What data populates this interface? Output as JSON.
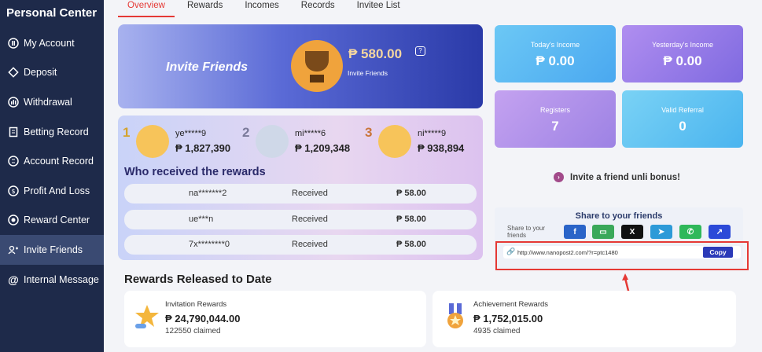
{
  "sidebar": {
    "title": "Personal Center",
    "items": [
      {
        "label": "My Account",
        "icon": "account-icon"
      },
      {
        "label": "Deposit",
        "icon": "deposit-icon"
      },
      {
        "label": "Withdrawal",
        "icon": "withdrawal-icon"
      },
      {
        "label": "Betting Record",
        "icon": "betting-record-icon"
      },
      {
        "label": "Account Record",
        "icon": "account-record-icon"
      },
      {
        "label": "Profit And Loss",
        "icon": "profit-loss-icon"
      },
      {
        "label": "Reward Center",
        "icon": "reward-center-icon"
      },
      {
        "label": "Invite Friends",
        "icon": "invite-friends-icon",
        "active": true
      },
      {
        "label": "Internal Message",
        "icon": "at-icon"
      }
    ]
  },
  "tabs": [
    "Overview",
    "Rewards",
    "Incomes",
    "Records",
    "Invitee List"
  ],
  "invite": {
    "label": "Invite Friends",
    "amount": "₱ 580.00",
    "amount_label": "Invite Friends"
  },
  "top_ranks": [
    {
      "rank": "1",
      "name": "ye*****9",
      "amount": "₱ 1,827,390"
    },
    {
      "rank": "2",
      "name": "mi*****6",
      "amount": "₱ 1,209,348"
    },
    {
      "rank": "3",
      "name": "ni*****9",
      "amount": "₱ 938,894"
    }
  ],
  "received": {
    "title": "Who received the rewards",
    "rows": [
      {
        "user": "na*******2",
        "status": "Received",
        "amount": "₱  58.00"
      },
      {
        "user": "ue***n",
        "status": "Received",
        "amount": "₱  58.00"
      },
      {
        "user": "7x********0",
        "status": "Received",
        "amount": "₱  58.00"
      }
    ]
  },
  "stats": [
    {
      "label": "Today's Income",
      "value": "₱  0.00",
      "color": "#5bbcf3"
    },
    {
      "label": "Yesterday's Income",
      "value": "₱  0.00",
      "color": "#9b7be8"
    },
    {
      "label": "Registers",
      "value": "7",
      "color": "#b393e8"
    },
    {
      "label": "Valid Referral",
      "value": "0",
      "color": "#5fc6f0"
    }
  ],
  "promo": "Invite a friend unli bonus!",
  "share": {
    "title": "Share to your friends",
    "label": "Share to your friends",
    "buttons": [
      {
        "name": "facebook",
        "glyph": "f",
        "color": "#2a64c8"
      },
      {
        "name": "sms",
        "glyph": "▭",
        "color": "#3aa85a"
      },
      {
        "name": "x",
        "glyph": "X",
        "color": "#111111"
      },
      {
        "name": "telegram",
        "glyph": "➤",
        "color": "#2d9ad8"
      },
      {
        "name": "whatsapp",
        "glyph": "✆",
        "color": "#2fb85a"
      },
      {
        "name": "more",
        "glyph": "↗",
        "color": "#2c4ad8"
      }
    ],
    "url": "http://www.nanopost2.com/?r=ptc1480",
    "copy": "Copy"
  },
  "released": {
    "title": "Rewards Released to Date",
    "cards": [
      {
        "title": "Invitation Rewards",
        "value": "₱  24,790,044.00",
        "claimed": "122550 claimed"
      },
      {
        "title": "Achievement Rewards",
        "value": "₱  1,752,015.00",
        "claimed": "4935 claimed"
      }
    ]
  },
  "colors": {
    "accent": "#e53935",
    "sidebar": "#1e2a4a"
  }
}
